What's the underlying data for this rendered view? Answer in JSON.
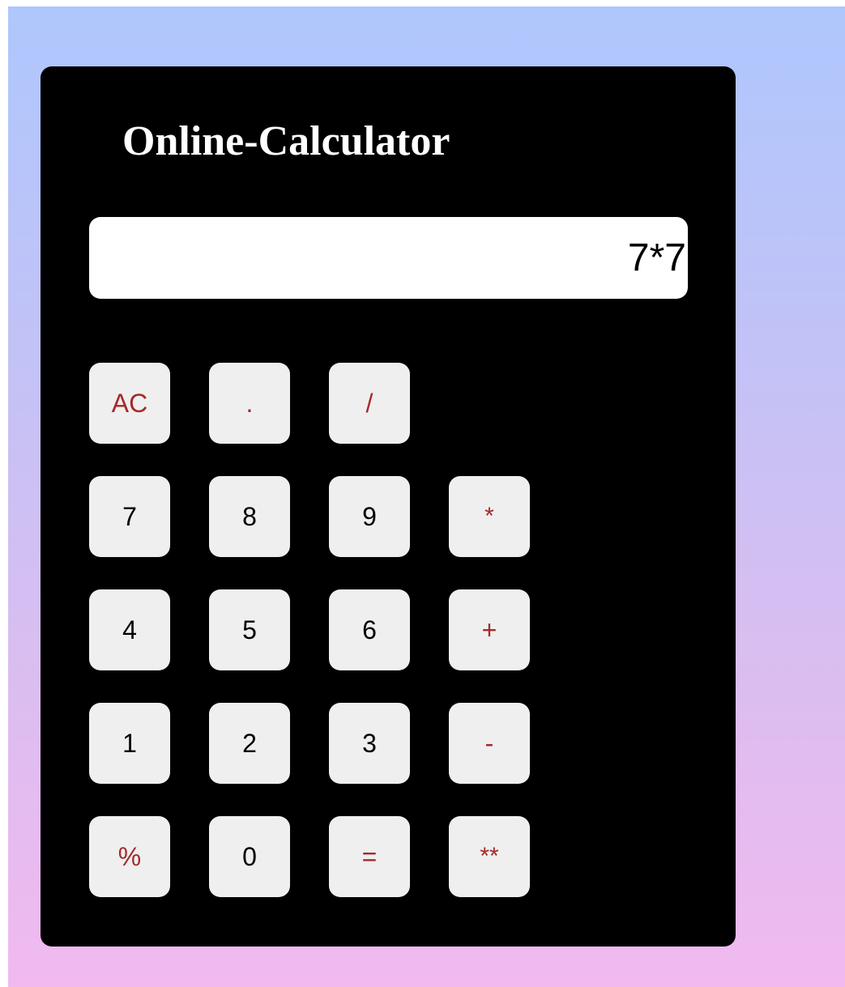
{
  "calculator": {
    "title": "Online-Calculator",
    "display_value": "7*7",
    "keys": {
      "ac": "AC",
      "dot": ".",
      "divide": "/",
      "seven": "7",
      "eight": "8",
      "nine": "9",
      "multiply": "*",
      "four": "4",
      "five": "5",
      "six": "6",
      "plus": "+",
      "one": "1",
      "two": "2",
      "three": "3",
      "minus": "-",
      "percent": "%",
      "zero": "0",
      "equals": "=",
      "power": "**"
    }
  },
  "colors": {
    "background_top": "#aec7fd",
    "background_bottom": "#f1b9ef",
    "calculator_body": "#000000",
    "key_background": "#efefef",
    "operator_text": "#a52a2a",
    "digit_text": "#000000",
    "title_text": "#ffffff"
  }
}
